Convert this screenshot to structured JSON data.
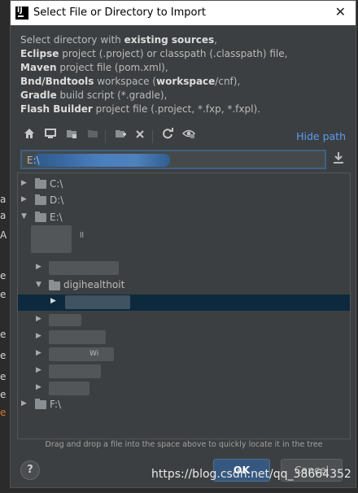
{
  "window": {
    "title": "Select File or Directory to Import",
    "close_icon": "close-icon"
  },
  "description": {
    "line1_pre": "Select directory with ",
    "line1_bold": "existing sources",
    "line1_post": ",",
    "line2_bold": "Eclipse",
    "line2_post": " project (.project) or classpath (.classpath) file,",
    "line3_bold": "Maven",
    "line3_post": " project file (pom.xml),",
    "line4_bold": "Bnd/Bndtools",
    "line4_mid": " workspace (",
    "line4_bold2": "workspace",
    "line4_post": "/cnf),",
    "line5_bold": "Gradle",
    "line5_post": " build script (*.gradle),",
    "line6_bold": "Flash Builder",
    "line6_post": " project file (.project, *.fxp, *.fxpl)."
  },
  "toolbar": {
    "icons": [
      "home-icon",
      "desktop-icon",
      "project-folder-icon",
      "module-folder-icon",
      "new-folder-icon",
      "delete-icon",
      "refresh-icon",
      "show-hidden-icon"
    ],
    "hide_path_label": "Hide path"
  },
  "path": {
    "value": "E:\\"
  },
  "tree": {
    "items": [
      {
        "label": "C:\\"
      },
      {
        "label": "D:\\"
      },
      {
        "label": "E:\\"
      },
      {
        "label": "F:\\"
      }
    ],
    "partial_labels": [
      "ll",
      "digihealthoit",
      "Wi"
    ]
  },
  "hint": "Drag and drop a file into the space above to quickly locate it in the tree",
  "buttons": {
    "help": "?",
    "ok": "OK",
    "cancel": "Cancel"
  },
  "watermark": "https://blog.csdn.net/qq_38664352",
  "colors": {
    "accent": "#365880",
    "link": "#589df6",
    "selection": "#0d293e",
    "background": "#3c3f41"
  }
}
